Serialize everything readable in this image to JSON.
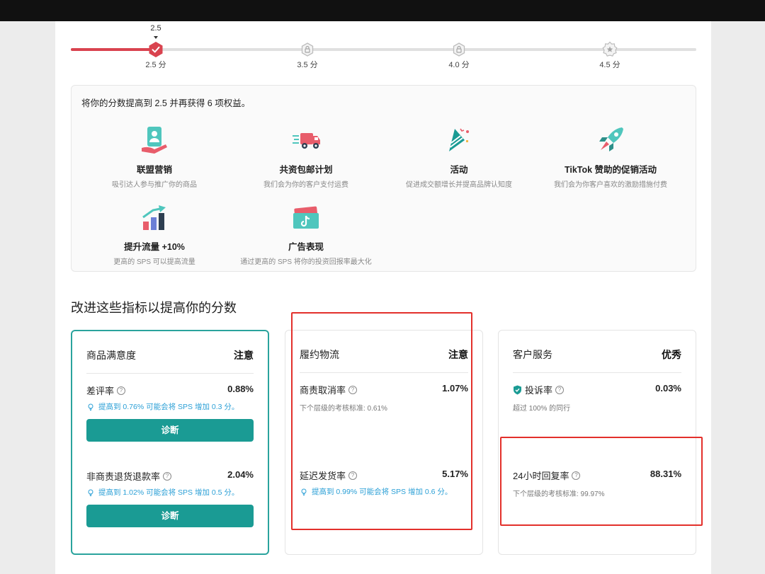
{
  "progress": {
    "current_value": "2.5",
    "fill_fraction": 0.136,
    "nodes": [
      {
        "label": "2.5 分",
        "state": "achieved"
      },
      {
        "label": "3.5 分",
        "state": "locked"
      },
      {
        "label": "4.0 分",
        "state": "locked"
      },
      {
        "label": "4.5 分",
        "state": "top"
      }
    ]
  },
  "benefits": {
    "title": "将你的分数提高到 2.5 并再获得 6 项权益。",
    "items": [
      {
        "icon": "affiliate-icon",
        "name": "联盟营销",
        "desc": "吸引达人参与推广你的商品"
      },
      {
        "icon": "shipping-truck-icon",
        "name": "共资包邮计划",
        "desc": "我们会为你的客户支付运费"
      },
      {
        "icon": "party-popper-icon",
        "name": "活动",
        "desc": "促进成交额增长并提高品牌认知度"
      },
      {
        "icon": "rocket-icon",
        "name": "TikTok 赞助的促销活动",
        "desc": "我们会为你客户喜欢的激励措施付费"
      },
      {
        "icon": "growth-chart-icon",
        "name": "提升流量 +10%",
        "desc": "更高的 SPS 可以提高流量"
      },
      {
        "icon": "ad-ticket-icon",
        "name": "广告表现",
        "desc": "通过更高的 SPS 将你的投资回报率最大化"
      }
    ]
  },
  "section_title": "改进这些指标以提高你的分数",
  "cards": [
    {
      "name": "商品满意度",
      "status": "注意",
      "metrics": [
        {
          "name": "差评率",
          "value": "0.88%",
          "hint": "提高到 0.76% 可能会将 SPS 增加 0.3 分。",
          "button": "诊断"
        },
        {
          "name": "非商责退货退款率",
          "value": "2.04%",
          "hint": "提高到 1.02% 可能会将 SPS 增加 0.5 分。",
          "button": "诊断"
        }
      ]
    },
    {
      "name": "履约物流",
      "status": "注意",
      "metrics": [
        {
          "name": "商责取消率",
          "value": "1.07%",
          "sub": "下个层级的考核标准: 0.61%"
        },
        {
          "name": "延迟发货率",
          "value": "5.17%",
          "hint": "提高到 0.99% 可能会将 SPS 增加 0.6 分。"
        }
      ]
    },
    {
      "name": "客户服务",
      "status": "优秀",
      "metrics": [
        {
          "name": "投诉率",
          "value": "0.03%",
          "sub": "超过 100% 的同行"
        },
        {
          "name": "24小时回复率",
          "value": "88.31%",
          "sub": "下个层级的考核标准: 99.97%"
        }
      ]
    }
  ],
  "colors": {
    "accent_red": "#d9434f",
    "teal": "#1a9b94",
    "hint_blue": "#2a9fd6",
    "highlight_red": "#e3302b"
  }
}
